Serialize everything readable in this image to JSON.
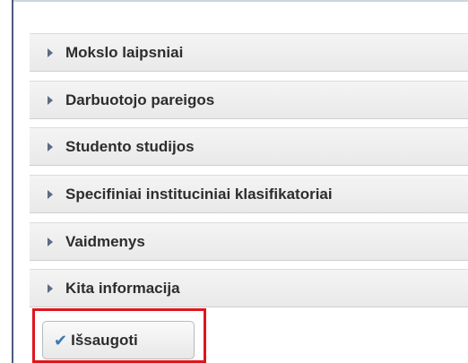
{
  "accordion": {
    "items": [
      {
        "label": "Mokslo laipsniai"
      },
      {
        "label": "Darbuotojo pareigos"
      },
      {
        "label": "Studento studijos"
      },
      {
        "label": "Specifiniai instituciniai klasifikatoriai"
      },
      {
        "label": "Vaidmenys"
      },
      {
        "label": "Kita informacija"
      }
    ]
  },
  "actions": {
    "save_label": "Išsaugoti",
    "save_icon": "check-icon"
  },
  "colors": {
    "highlight_outline": "#e0151c",
    "check_icon": "#3a78b5",
    "left_rule": "#4a5d80"
  }
}
